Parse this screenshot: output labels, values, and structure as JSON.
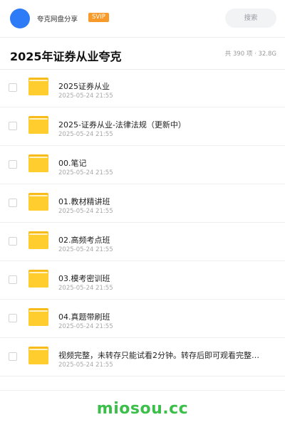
{
  "header": {
    "username": "夸克网盘分享",
    "badge": "SVIP",
    "search_placeholder": "搜索",
    "colors": {
      "avatar": "#2d7bf7",
      "badge": "#f79a2a"
    }
  },
  "folder_title": {
    "title": "2025年证券从业夸克",
    "meta": "共 390 项 · 32.8G"
  },
  "files": [
    {
      "name": "2025证券从业",
      "date": "2025-05-24 21:55"
    },
    {
      "name": "2025-证券从业-法律法规（更新中）",
      "date": "2025-05-24 21:55"
    },
    {
      "name": "00.笔记",
      "date": "2025-05-24 21:55"
    },
    {
      "name": "01.教材精讲班",
      "date": "2025-05-24 21:55"
    },
    {
      "name": "02.高频考点班",
      "date": "2025-05-24 21:55"
    },
    {
      "name": "03.模考密训班",
      "date": "2025-05-24 21:55"
    },
    {
      "name": "04.真题带刷班",
      "date": "2025-05-24 21:55"
    },
    {
      "name": "视频完整，未转存只能试看2分钟。转存后即可观看完整…",
      "date": "2025-05-24 21:55"
    }
  ],
  "watermark": "miosou.cc"
}
